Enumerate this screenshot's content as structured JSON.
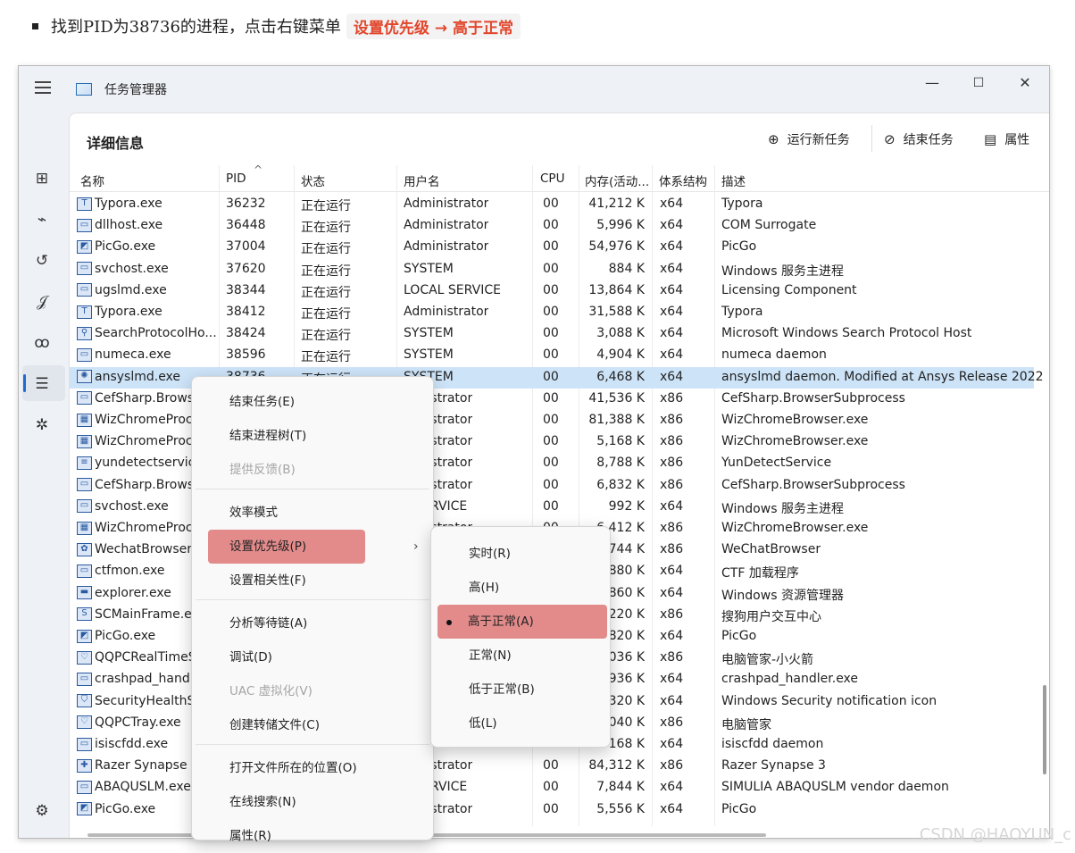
{
  "doc": {
    "text": "找到PID为38736的进程，点击右键菜单",
    "code": "设置优先级 → 高于正常"
  },
  "window": {
    "title": "任务管理器",
    "minimize": "—",
    "maximize": "☐",
    "close": "✕"
  },
  "sidebar": [
    {
      "name": "processes-icon",
      "glyph": "⊞"
    },
    {
      "name": "performance-icon",
      "glyph": "⌁"
    },
    {
      "name": "app-history-icon",
      "glyph": "↺"
    },
    {
      "name": "startup-apps-icon",
      "glyph": "𝒥"
    },
    {
      "name": "users-icon",
      "glyph": "ꝏ"
    },
    {
      "name": "details-icon",
      "glyph": "☰"
    },
    {
      "name": "services-icon",
      "glyph": "✲"
    }
  ],
  "settings_glyph": "⚙",
  "page_title": "详细信息",
  "toolbar": {
    "run_new_task": "运行新任务",
    "end_task": "结束任务",
    "properties": "属性"
  },
  "columns": {
    "name": "名称",
    "pid": "PID",
    "state": "状态",
    "user": "用户名",
    "cpu": "CPU",
    "mem": "内存(活动...",
    "arch": "体系结构",
    "desc": "描述"
  },
  "rows": [
    {
      "name": "Typora.exe",
      "icon": "T",
      "pid": "36232",
      "state": "正在运行",
      "user": "Administrator",
      "cpu": "00",
      "mem": "41,212 K",
      "arch": "x64",
      "desc": "Typora"
    },
    {
      "name": "dllhost.exe",
      "icon": "▭",
      "pid": "36448",
      "state": "正在运行",
      "user": "Administrator",
      "cpu": "00",
      "mem": "5,996 K",
      "arch": "x64",
      "desc": "COM Surrogate"
    },
    {
      "name": "PicGo.exe",
      "icon": "◩",
      "pid": "37004",
      "state": "正在运行",
      "user": "Administrator",
      "cpu": "00",
      "mem": "54,976 K",
      "arch": "x64",
      "desc": "PicGo"
    },
    {
      "name": "svchost.exe",
      "icon": "▭",
      "pid": "37620",
      "state": "正在运行",
      "user": "SYSTEM",
      "cpu": "00",
      "mem": "884 K",
      "arch": "x64",
      "desc": "Windows 服务主进程"
    },
    {
      "name": "ugslmd.exe",
      "icon": "▭",
      "pid": "38344",
      "state": "正在运行",
      "user": "LOCAL SERVICE",
      "cpu": "00",
      "mem": "13,864 K",
      "arch": "x64",
      "desc": "Licensing Component"
    },
    {
      "name": "Typora.exe",
      "icon": "T",
      "pid": "38412",
      "state": "正在运行",
      "user": "Administrator",
      "cpu": "00",
      "mem": "31,588 K",
      "arch": "x64",
      "desc": "Typora"
    },
    {
      "name": "SearchProtocolHo...",
      "icon": "⚲",
      "pid": "38424",
      "state": "正在运行",
      "user": "SYSTEM",
      "cpu": "00",
      "mem": "3,088 K",
      "arch": "x64",
      "desc": "Microsoft Windows Search Protocol Host"
    },
    {
      "name": "numeca.exe",
      "icon": "▭",
      "pid": "38596",
      "state": "正在运行",
      "user": "SYSTEM",
      "cpu": "00",
      "mem": "4,904 K",
      "arch": "x64",
      "desc": "numeca daemon"
    },
    {
      "name": "ansyslmd.exe",
      "icon": "✺",
      "pid": "38736",
      "state": "正在运行",
      "user": "SYSTEM",
      "cpu": "00",
      "mem": "6,468 K",
      "arch": "x64",
      "desc": "ansyslmd daemon.  Modified at Ansys Release 2022",
      "selected": true
    },
    {
      "name": "CefSharp.Browse",
      "icon": "▭",
      "pid": "",
      "state": "",
      "user": "ministrator",
      "cpu": "00",
      "mem": "41,536 K",
      "arch": "x86",
      "desc": "CefSharp.BrowserSubprocess"
    },
    {
      "name": "WizChromeProce",
      "icon": "▦",
      "pid": "",
      "state": "",
      "user": "ministrator",
      "cpu": "00",
      "mem": "81,388 K",
      "arch": "x86",
      "desc": "WizChromeBrowser.exe"
    },
    {
      "name": "WizChromeProce",
      "icon": "▦",
      "pid": "",
      "state": "",
      "user": "ministrator",
      "cpu": "00",
      "mem": "5,168 K",
      "arch": "x86",
      "desc": "WizChromeBrowser.exe"
    },
    {
      "name": "yundetectservice",
      "icon": "≡",
      "pid": "",
      "state": "",
      "user": "ministrator",
      "cpu": "00",
      "mem": "8,788 K",
      "arch": "x86",
      "desc": "YunDetectService"
    },
    {
      "name": "CefSharp.Browse",
      "icon": "▭",
      "pid": "",
      "state": "",
      "user": "ministrator",
      "cpu": "00",
      "mem": "6,832 K",
      "arch": "x86",
      "desc": "CefSharp.BrowserSubprocess"
    },
    {
      "name": "svchost.exe",
      "icon": "▭",
      "pid": "",
      "state": "",
      "user": "L SERVICE",
      "cpu": "00",
      "mem": "992 K",
      "arch": "x64",
      "desc": "Windows 服务主进程"
    },
    {
      "name": "WizChromeProce",
      "icon": "▦",
      "pid": "",
      "state": "",
      "user": "ministrator",
      "cpu": "00",
      "mem": "6,412 K",
      "arch": "x86",
      "desc": "WizChromeBrowser.exe"
    },
    {
      "name": "WechatBrowser.e",
      "icon": "✿",
      "pid": "",
      "state": "",
      "user": "",
      "cpu": "",
      "mem": "744 K",
      "arch": "x86",
      "desc": "WeChatBrowser"
    },
    {
      "name": "ctfmon.exe",
      "icon": "▭",
      "pid": "",
      "state": "",
      "user": "",
      "cpu": "",
      "mem": "880 K",
      "arch": "x64",
      "desc": "CTF 加载程序"
    },
    {
      "name": "explorer.exe",
      "icon": "▬",
      "pid": "",
      "state": "",
      "user": "",
      "cpu": "",
      "mem": "860 K",
      "arch": "x64",
      "desc": "Windows 资源管理器"
    },
    {
      "name": "SCMainFrame.ex",
      "icon": "S",
      "pid": "",
      "state": "",
      "user": "",
      "cpu": "",
      "mem": "220 K",
      "arch": "x86",
      "desc": "搜狗用户交互中心"
    },
    {
      "name": "PicGo.exe",
      "icon": "◩",
      "pid": "",
      "state": "",
      "user": "",
      "cpu": "",
      "mem": "820 K",
      "arch": "x64",
      "desc": "PicGo"
    },
    {
      "name": "QQPCRealTimeS",
      "icon": "♡",
      "pid": "",
      "state": "",
      "user": "",
      "cpu": "",
      "mem": "036 K",
      "arch": "x86",
      "desc": "电脑管家-小火箭"
    },
    {
      "name": "crashpad_handle",
      "icon": "▭",
      "pid": "",
      "state": "",
      "user": "",
      "cpu": "",
      "mem": "936 K",
      "arch": "x64",
      "desc": "crashpad_handler.exe"
    },
    {
      "name": "SecurityHealthSy",
      "icon": "⛉",
      "pid": "",
      "state": "",
      "user": "",
      "cpu": "",
      "mem": "320 K",
      "arch": "x64",
      "desc": "Windows Security notification icon"
    },
    {
      "name": "QQPCTray.exe",
      "icon": "♡",
      "pid": "",
      "state": "",
      "user": "",
      "cpu": "",
      "mem": "040 K",
      "arch": "x86",
      "desc": "电脑管家"
    },
    {
      "name": "isiscfdd.exe",
      "icon": "▭",
      "pid": "",
      "state": "",
      "user": "",
      "cpu": "",
      "mem": "168 K",
      "arch": "x64",
      "desc": "isiscfdd daemon"
    },
    {
      "name": "Razer Synapse 3",
      "icon": "✚",
      "pid": "",
      "state": "",
      "user": "ministrator",
      "cpu": "00",
      "mem": "84,312 K",
      "arch": "x86",
      "desc": "Razer Synapse 3"
    },
    {
      "name": "ABAQUSLM.exe",
      "icon": "▭",
      "pid": "",
      "state": "",
      "user": "L SERVICE",
      "cpu": "00",
      "mem": "7,844 K",
      "arch": "x64",
      "desc": "SIMULIA ABAQUSLM vendor daemon"
    },
    {
      "name": "PicGo.exe",
      "icon": "◩",
      "pid": "",
      "state": "",
      "user": "ministrator",
      "cpu": "00",
      "mem": "5,556 K",
      "arch": "x64",
      "desc": "PicGo"
    }
  ],
  "context_menu": [
    {
      "label": "结束任务(E)",
      "disabled": false
    },
    {
      "label": "结束进程树(T)",
      "disabled": false
    },
    {
      "label": "提供反馈(B)",
      "disabled": true
    },
    {
      "label": "效率模式",
      "disabled": false
    },
    {
      "label": "设置优先级(P)",
      "disabled": false,
      "highlight": true,
      "submenu": true
    },
    {
      "label": "设置相关性(F)",
      "disabled": false
    },
    {
      "label": "分析等待链(A)",
      "disabled": false
    },
    {
      "label": "调试(D)",
      "disabled": false
    },
    {
      "label": "UAC 虚拟化(V)",
      "disabled": true
    },
    {
      "label": "创建转储文件(C)",
      "disabled": false
    },
    {
      "label": "打开文件所在的位置(O)",
      "disabled": false
    },
    {
      "label": "在线搜索(N)",
      "disabled": false
    },
    {
      "label": "属性(R)",
      "disabled": false
    }
  ],
  "submenu_chevron": "›",
  "priority_menu": [
    {
      "label": "实时(R)"
    },
    {
      "label": "高(H)"
    },
    {
      "label": "高于正常(A)",
      "checked": true,
      "highlight": true
    },
    {
      "label": "正常(N)"
    },
    {
      "label": "低于正常(B)"
    },
    {
      "label": "低(L)"
    }
  ],
  "watermark": "CSDN @HAOYUN_c"
}
